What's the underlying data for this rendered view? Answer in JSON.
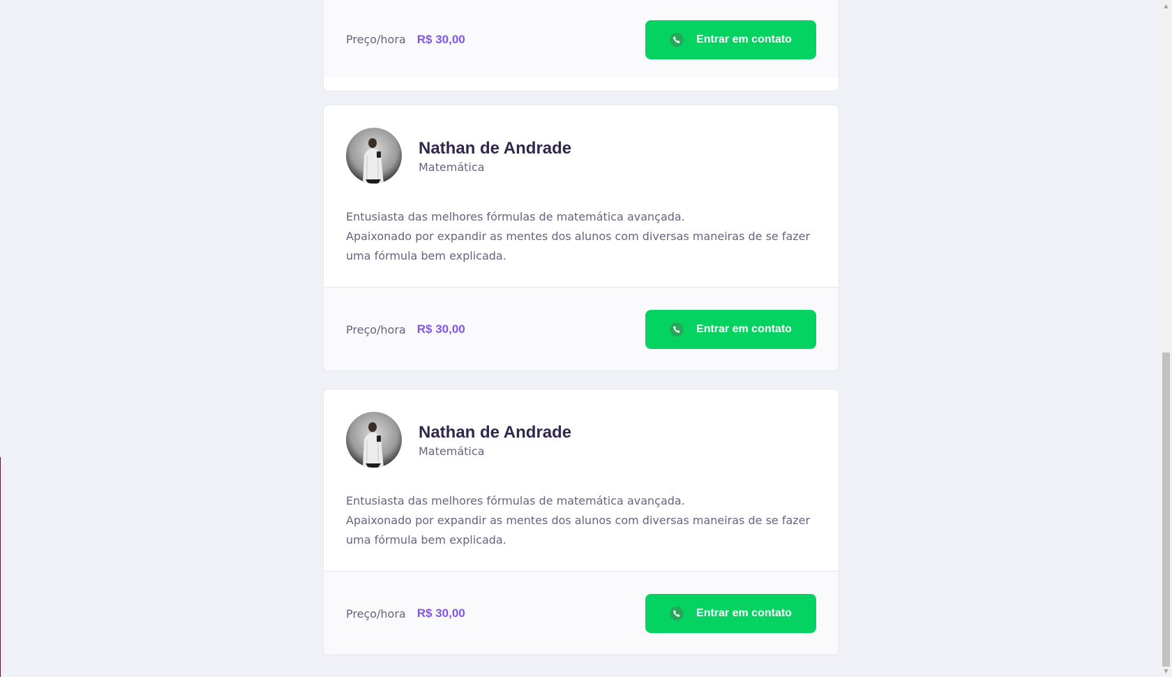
{
  "cards": [
    {
      "price_label": "Preço/hora",
      "price_value": "R$ 30,00",
      "button_label": "Entrar em contato"
    },
    {
      "name": "Nathan de Andrade",
      "subject": "Matemática",
      "bio_line1": "Entusiasta das melhores fórmulas de matemática avançada.",
      "bio_line2": "Apaixonado por expandir as mentes dos alunos com diversas maneiras de se fazer uma fórmula bem explicada.",
      "price_label": "Preço/hora",
      "price_value": "R$ 30,00",
      "button_label": "Entrar em contato"
    },
    {
      "name": "Nathan de Andrade",
      "subject": "Matemática",
      "bio_line1": "Entusiasta das melhores fórmulas de matemática avançada.",
      "bio_line2": "Apaixonado por expandir as mentes dos alunos com diversas maneiras de se fazer uma fórmula bem explicada.",
      "price_label": "Preço/hora",
      "price_value": "R$ 30,00",
      "button_label": "Entrar em contato"
    }
  ],
  "icons": {
    "contact": "whatsapp-icon",
    "avatar": "avatar"
  },
  "colors": {
    "background": "#f0f0f7",
    "primary": "#8257e5",
    "button": "#04d361",
    "title": "#32264d",
    "text": "#6a6180"
  }
}
